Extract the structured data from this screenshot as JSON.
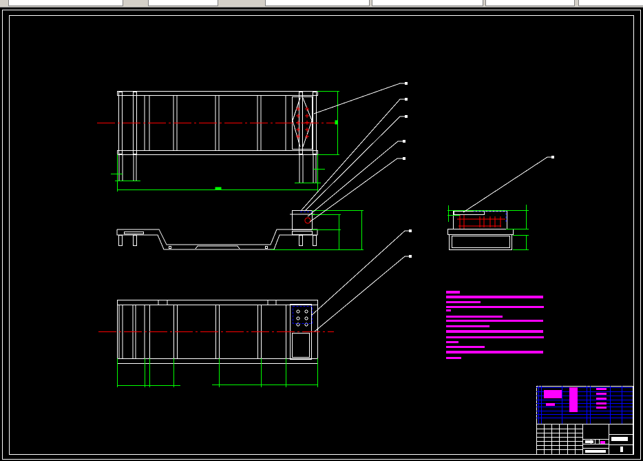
{
  "app": {
    "type": "cad-viewer"
  },
  "toolbar": {
    "icons": [
      "layer-icon",
      "layer-state-icon",
      "properties-icon"
    ]
  },
  "drawing": {
    "background": "#000000",
    "colors": {
      "outline": "#ffffff",
      "dimension": "#00ff00",
      "centerline": "#ff0000",
      "hidden": "#0000ff",
      "notes": "#ff00ff",
      "title_block_grid": "#0000ff"
    },
    "views": [
      "front-view",
      "side-view",
      "top-view",
      "end-view"
    ],
    "leaders": 8
  }
}
